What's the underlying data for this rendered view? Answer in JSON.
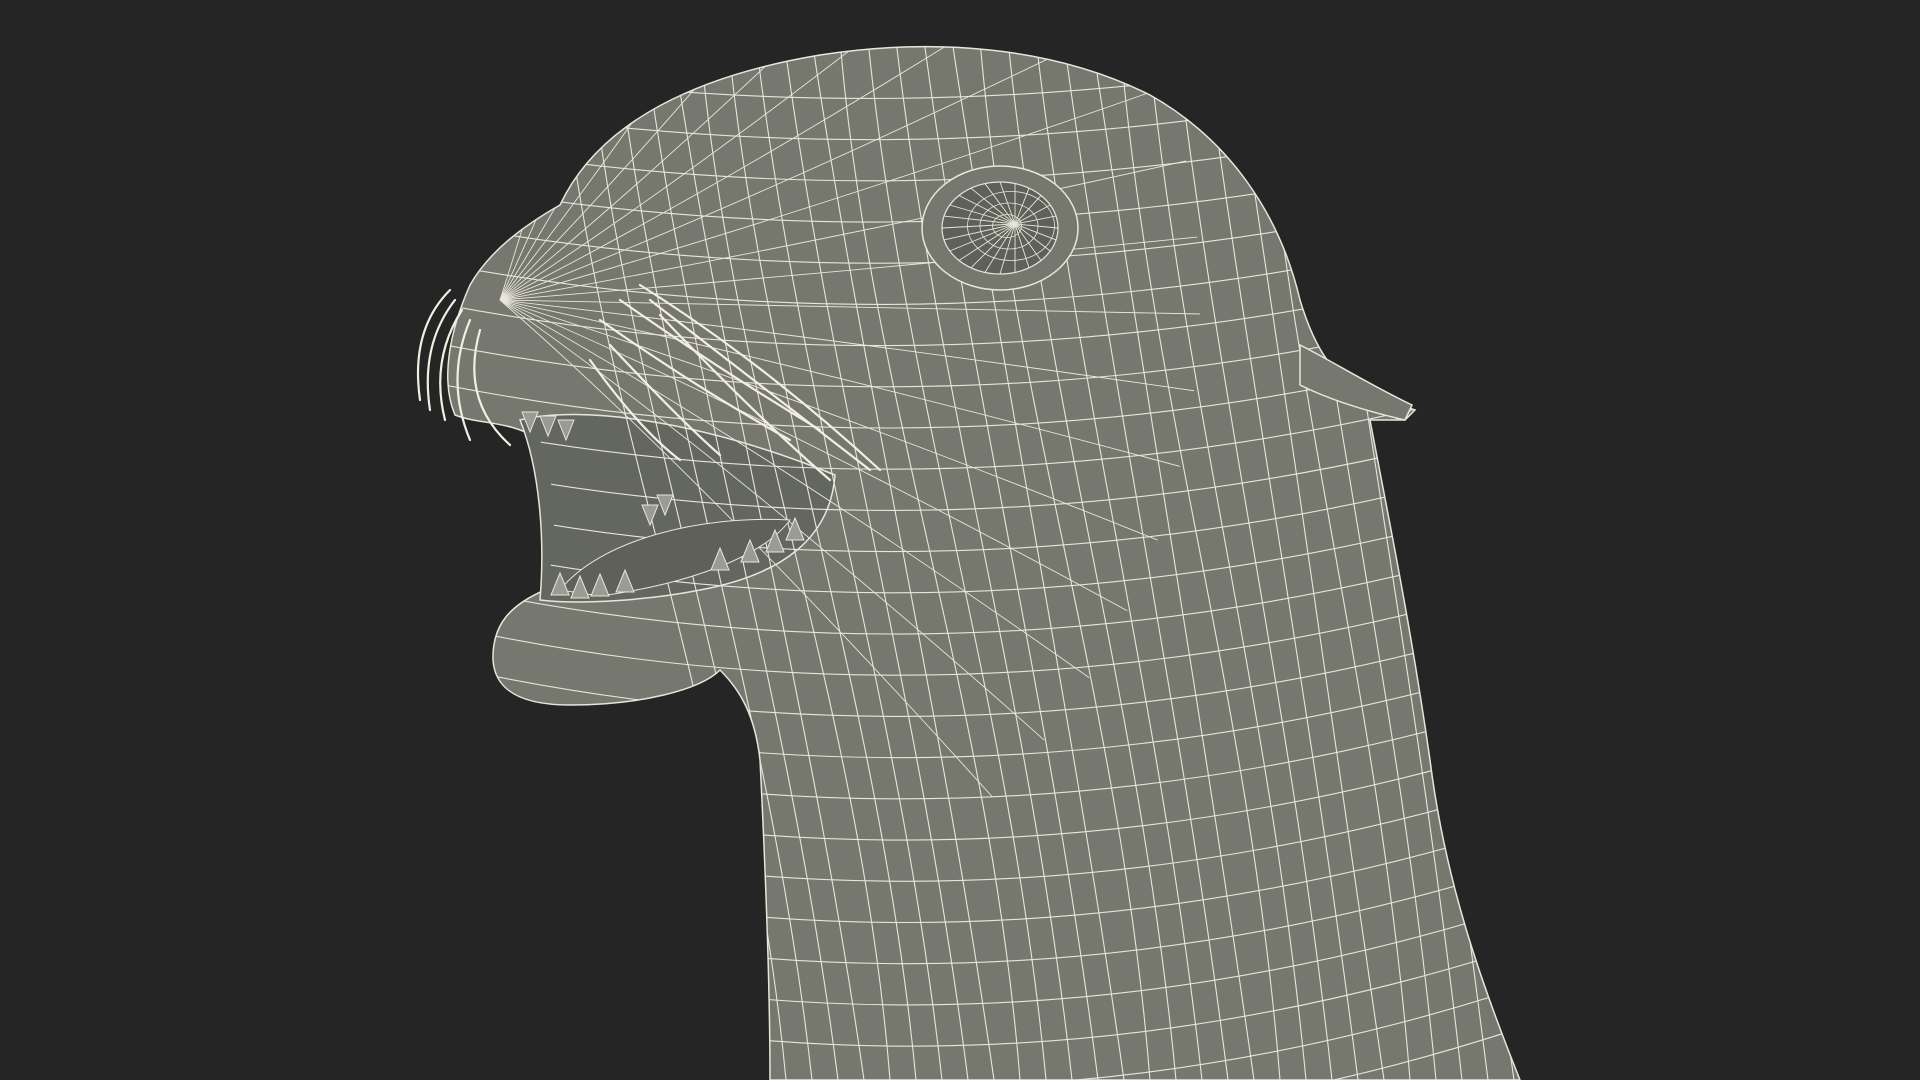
{
  "viewport": {
    "background_color": "#252525",
    "subject": "sea-lion-head-wireframe",
    "render_mode": "wireframe-on-shaded",
    "colors": {
      "surface": "#767870",
      "surface_dark": "#5e6059",
      "mouth_interior": "#646760",
      "wire": "#e8e6da",
      "whisker": "#f2efe2"
    }
  }
}
